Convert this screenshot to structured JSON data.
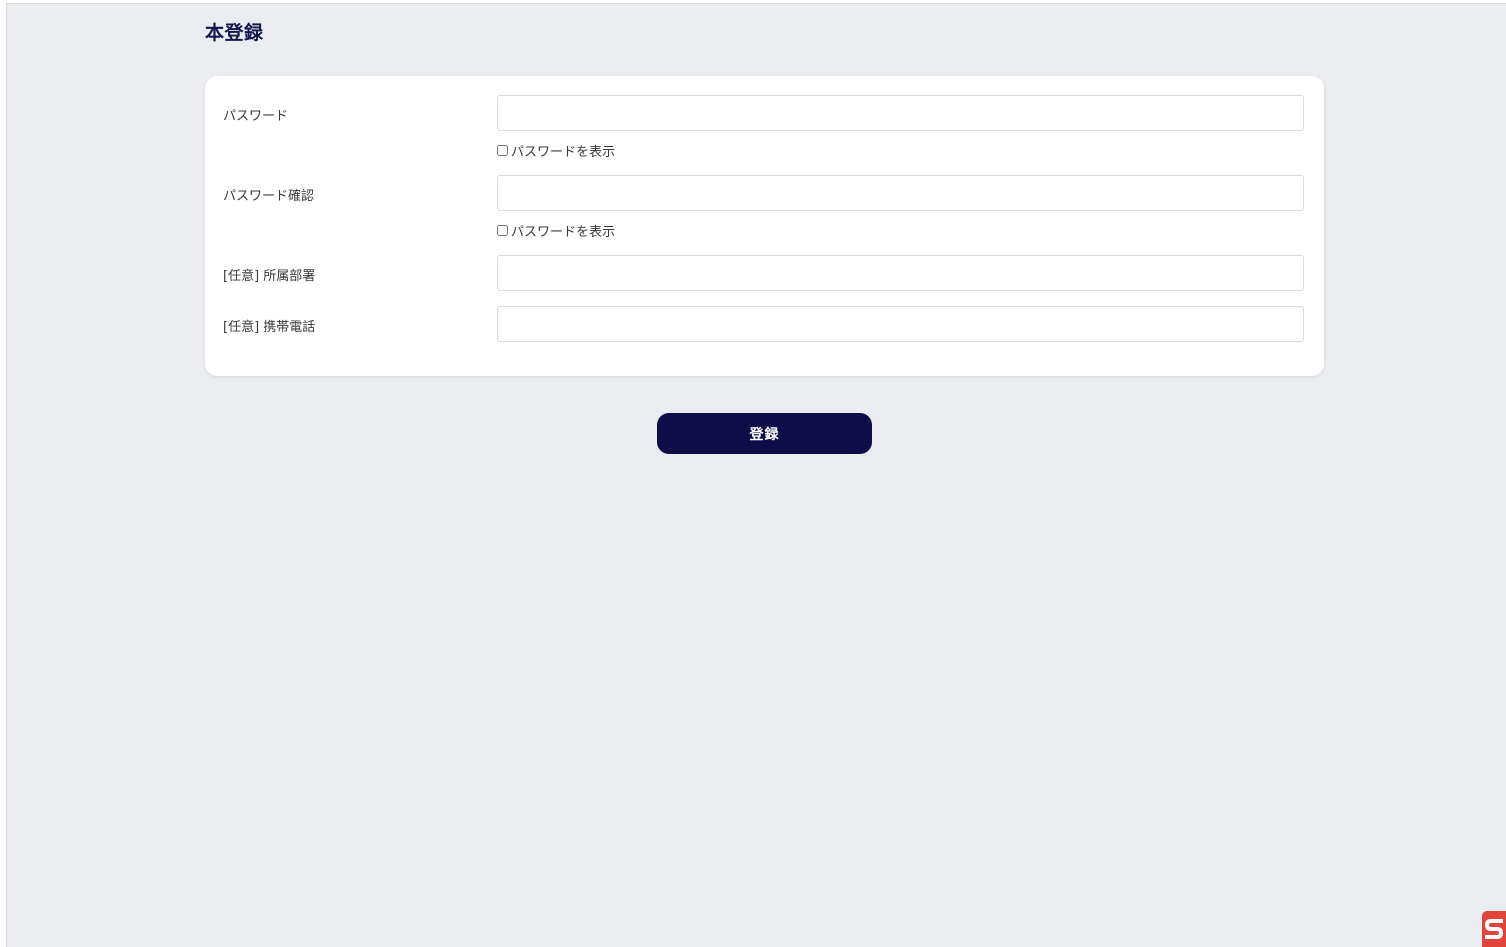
{
  "page": {
    "title": "本登録"
  },
  "form": {
    "password": {
      "label": "パスワード",
      "value": "",
      "show_label": "パスワードを表示"
    },
    "password_confirm": {
      "label": "パスワード確認",
      "value": "",
      "show_label": "パスワードを表示"
    },
    "department": {
      "label": "[任意] 所属部署",
      "value": ""
    },
    "mobile_phone": {
      "label": "[任意] 携帯電話",
      "value": ""
    },
    "submit_label": "登録"
  },
  "colors": {
    "accent": "#0e0d4a",
    "background": "#eaecef",
    "badge": "#e0453c"
  },
  "icons": {
    "corner_badge": "brand-logo-icon"
  }
}
